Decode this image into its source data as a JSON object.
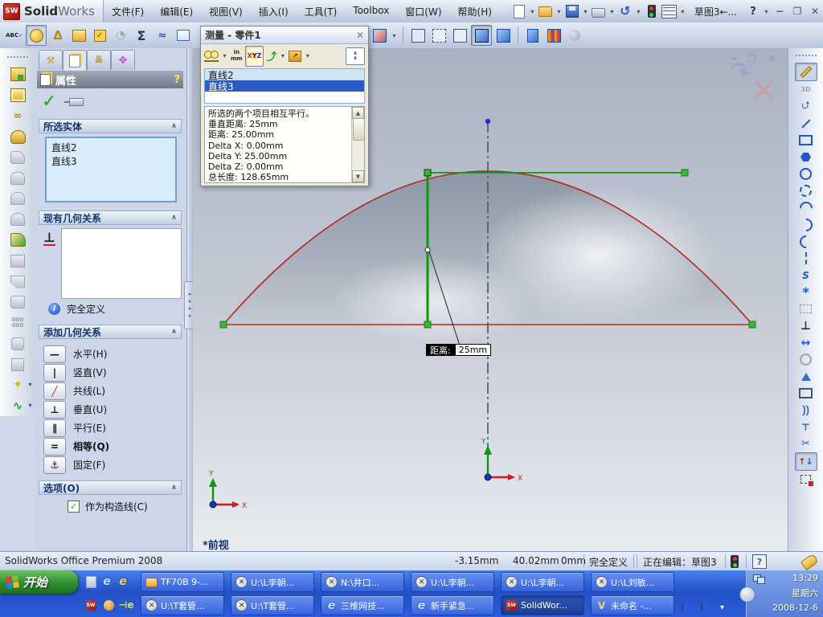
{
  "colors": {
    "taskbar_blue": "#2f62d8",
    "start_green": "#2e8a2e",
    "selection_blue": "#2a5cc4",
    "sketch_green": "#00a000",
    "sketch_red": "#c81e1e",
    "construction_gray": "#4a5568"
  },
  "titlebar": {
    "logo_badge": "SW",
    "logo_solid": "Solid",
    "logo_works": "Works",
    "menus": [
      {
        "label": "文件(F)"
      },
      {
        "label": "编辑(E)"
      },
      {
        "label": "视图(V)"
      },
      {
        "label": "插入(I)"
      },
      {
        "label": "工具(T)"
      },
      {
        "label": "Toolbox"
      },
      {
        "label": "窗口(W)"
      },
      {
        "label": "帮助(H)"
      }
    ],
    "sketch_box": "草图3←...",
    "help": "?",
    "minimize": "−",
    "restore": "❐",
    "close": "✕"
  },
  "toolbar2": {
    "spell": "ABC",
    "sigma": "Σ"
  },
  "measure_dialog": {
    "title": "测量 - 零件1",
    "close": "✕",
    "units_top": "in",
    "units_bottom": "mm",
    "xyz_x": "X",
    "xyz_y": "Y",
    "xyz_z": "Z",
    "items": [
      {
        "label": "直线2"
      },
      {
        "label": "直线3"
      }
    ],
    "results": [
      {
        "text": "所选的两个项目相互平行。"
      },
      {
        "text": "垂直距离: 25mm"
      },
      {
        "text": "距离: 25.00mm"
      },
      {
        "text": "Delta X: 0.00mm"
      },
      {
        "text": "Delta Y: 25.00mm"
      },
      {
        "text": "Delta Z: 0.00mm"
      },
      {
        "text": "总长度: 128.65mm"
      }
    ]
  },
  "prop_panel": {
    "title": "属性",
    "help": "?",
    "selected_entities": {
      "header": "所选实体",
      "items": [
        {
          "label": "直线2"
        },
        {
          "label": "直线3"
        }
      ]
    },
    "existing_relations": {
      "header": "现有几何关系",
      "status": "完全定义"
    },
    "add_relations": {
      "header": "添加几何关系",
      "buttons": [
        {
          "glyph": "—",
          "label": "水平(H)"
        },
        {
          "glyph": "|",
          "label": "竖直(V)"
        },
        {
          "glyph": "╱",
          "label": "共线(L)"
        },
        {
          "glyph": "⊥",
          "label": "垂直(U)"
        },
        {
          "glyph": "∥",
          "label": "平行(E)"
        },
        {
          "glyph": "=",
          "label": "相等(Q)"
        },
        {
          "glyph": "⚓",
          "label": "固定(F)"
        }
      ]
    },
    "options": {
      "header": "选项(O)",
      "construction": "作为构造线(C)"
    }
  },
  "canvas": {
    "tooltip_label": "距离:",
    "tooltip_value": "25mm",
    "view_label": "*前视",
    "axis_x": "X",
    "axis_y": "Y"
  },
  "statusbar": {
    "product": "SolidWorks Office Premium 2008",
    "coord1": "-3.15mm",
    "coord2": "40.02mm",
    "coord3": "0mm",
    "define_state": "完全定义",
    "editing": "正在编辑：草图3",
    "help": "?"
  },
  "taskbar": {
    "start": "开始",
    "row1": [
      {
        "label": "TF70B 9-..."
      },
      {
        "label": "U:\\L李朝..."
      },
      {
        "label": "N:\\井口..."
      },
      {
        "label": "U:\\L李朝..."
      },
      {
        "label": "U:\\L李朝..."
      },
      {
        "label": "U:\\L刘敏..."
      }
    ],
    "row2": [
      {
        "label": "U:\\T套管..."
      },
      {
        "label": "U:\\T套管..."
      },
      {
        "label": "三维网技..."
      },
      {
        "label": "新手紧急..."
      },
      {
        "label": "SolidWor..."
      },
      {
        "label": "未命名 -..."
      }
    ],
    "clock_time": "13:29",
    "clock_day": "星期六",
    "clock_date": "2008-12-6"
  }
}
